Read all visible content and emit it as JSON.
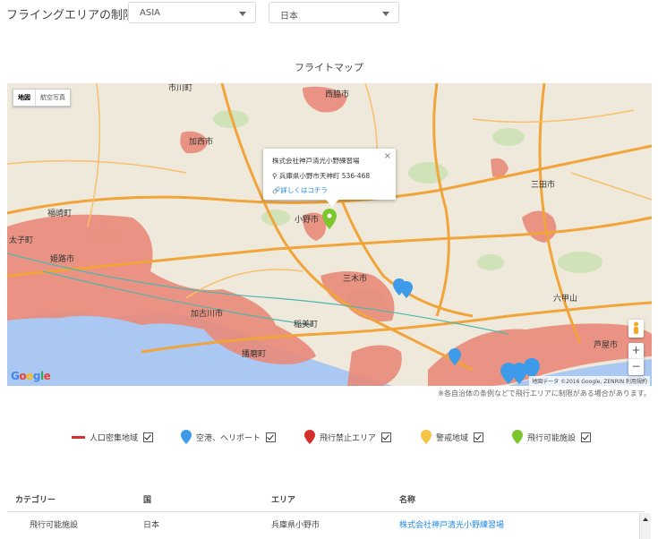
{
  "header": {
    "title": "フライングエリアの制限"
  },
  "filters": {
    "region": "ASIA",
    "country": "日本"
  },
  "map": {
    "title": "フライトマップ",
    "map_type_active": "地図",
    "map_type_inactive": "航空写真",
    "popup": {
      "name": "株式会社神戸清光小野練習場",
      "address": "兵庫県小野市天神町 536-468",
      "link": "詳しくはコチラ"
    },
    "google_logo": "Google",
    "copyright": "地図データ ©2016 Google, ZENRIN   利用規約",
    "zoom_in": "+",
    "zoom_out": "−",
    "city_labels": [
      "加西市",
      "西脇市",
      "三田市",
      "小野市",
      "三木市",
      "姫路市",
      "加古川市",
      "稲美町",
      "福崎町",
      "市川町",
      "太子町",
      "播磨町",
      "六甲山",
      "芦屋市"
    ],
    "colors": {
      "dense_area": "#e98a7a",
      "road": "#f0a43a",
      "sea": "#aac8f2"
    }
  },
  "note": "※各自治体の条例などで飛行エリアに制限がある場合があります。",
  "legend": [
    {
      "label": "人口密集地域",
      "icon": "dense-area-line",
      "color": "#d6302c"
    },
    {
      "label": "空港、ヘリポート",
      "icon": "pin-blue",
      "color": "#3d9be9"
    },
    {
      "label": "飛行禁止エリア",
      "icon": "pin-red",
      "color": "#d6302c"
    },
    {
      "label": "警戒地域",
      "icon": "pin-yellow",
      "color": "#f6c445"
    },
    {
      "label": "飛行可能施設",
      "icon": "pin-green",
      "color": "#7cc62e"
    }
  ],
  "table": {
    "headers": [
      "カテゴリー",
      "国",
      "エリア",
      "名称"
    ],
    "rows": [
      [
        "飛行可能施設",
        "日本",
        "兵庫県小野市",
        "株式会社神戸清光小野練習場"
      ]
    ]
  }
}
